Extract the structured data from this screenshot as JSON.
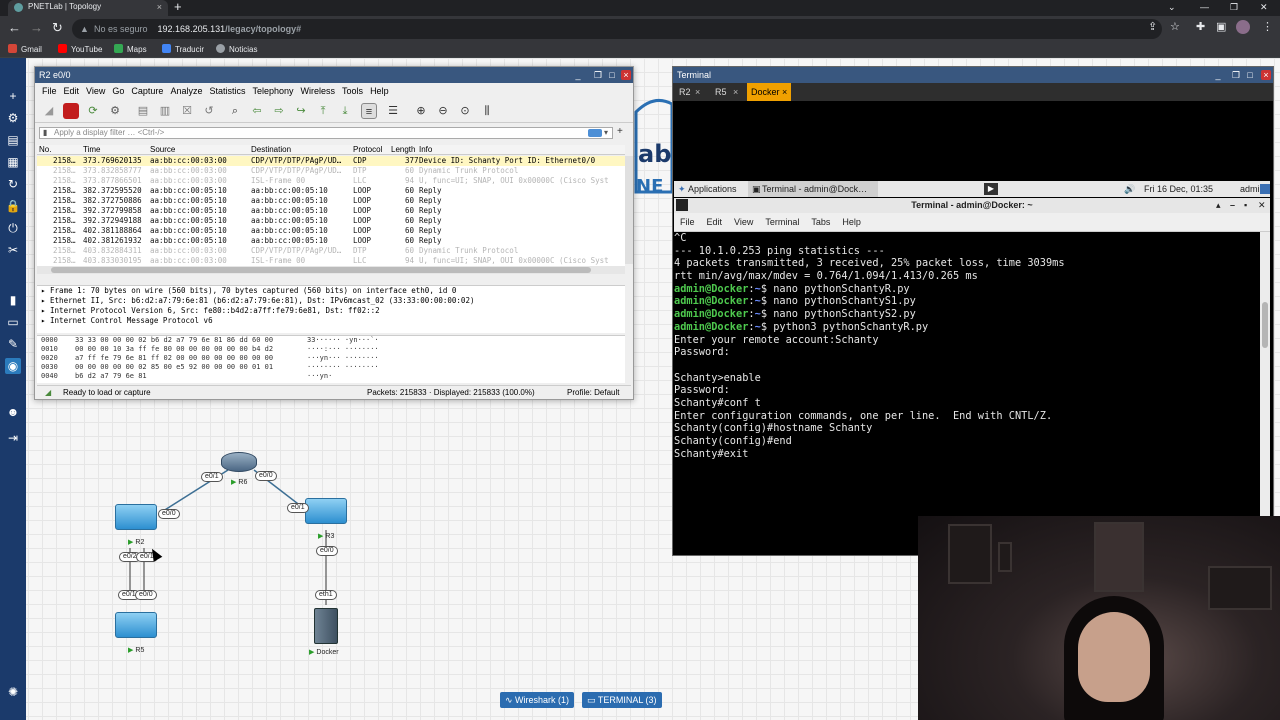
{
  "browser": {
    "tab_title": "PNETLab | Topology",
    "tab_close": "×",
    "new_tab": "+",
    "security_label": "No es seguro",
    "host": "192.168.205.131",
    "path": "/legacy/topology#",
    "bookmarks": [
      "Gmail",
      "YouTube",
      "Maps",
      "Traducir",
      "Noticias"
    ]
  },
  "wireshark": {
    "title": "R2 e0/0",
    "menu": [
      "File",
      "Edit",
      "View",
      "Go",
      "Capture",
      "Analyze",
      "Statistics",
      "Telephony",
      "Wireless",
      "Tools",
      "Help"
    ],
    "filter_placeholder": "Apply a display filter … <Ctrl-/>",
    "columns": [
      "No.",
      "Time",
      "Source",
      "Destination",
      "Protocol",
      "Length",
      "Info"
    ],
    "packets": [
      {
        "no": "2158…",
        "time": "373.769620135",
        "src": "aa:bb:cc:00:03:00",
        "dst": "CDP/VTP/DTP/PAgP/UD…",
        "proto": "CDP",
        "len": "377",
        "info": "Device ID: Schanty  Port ID: Ethernet0/0",
        "style": "sel"
      },
      {
        "no": "2158…",
        "time": "373.832858777",
        "src": "aa:bb:cc:00:03:00",
        "dst": "CDP/VTP/DTP/PAgP/UD…",
        "proto": "DTP",
        "len": "60",
        "info": "Dynamic Trunk Protocol",
        "style": "faded"
      },
      {
        "no": "2158…",
        "time": "373.877866501",
        "src": "aa:bb:cc:00:03:00",
        "dst": "ISL-Frame 00",
        "proto": "LLC",
        "len": "94",
        "info": "U, func=UI; SNAP, OUI 0x00000C (Cisco Syst",
        "style": "faded"
      },
      {
        "no": "2158…",
        "time": "382.372595520",
        "src": "aa:bb:cc:00:05:10",
        "dst": "aa:bb:cc:00:05:10",
        "proto": "LOOP",
        "len": "60",
        "info": "Reply",
        "style": "normal"
      },
      {
        "no": "2158…",
        "time": "382.372750886",
        "src": "aa:bb:cc:00:05:10",
        "dst": "aa:bb:cc:00:05:10",
        "proto": "LOOP",
        "len": "60",
        "info": "Reply",
        "style": "normal"
      },
      {
        "no": "2158…",
        "time": "392.372799858",
        "src": "aa:bb:cc:00:05:10",
        "dst": "aa:bb:cc:00:05:10",
        "proto": "LOOP",
        "len": "60",
        "info": "Reply",
        "style": "normal"
      },
      {
        "no": "2158…",
        "time": "392.372949188",
        "src": "aa:bb:cc:00:05:10",
        "dst": "aa:bb:cc:00:05:10",
        "proto": "LOOP",
        "len": "60",
        "info": "Reply",
        "style": "normal"
      },
      {
        "no": "2158…",
        "time": "402.381188864",
        "src": "aa:bb:cc:00:05:10",
        "dst": "aa:bb:cc:00:05:10",
        "proto": "LOOP",
        "len": "60",
        "info": "Reply",
        "style": "normal"
      },
      {
        "no": "2158…",
        "time": "402.381261932",
        "src": "aa:bb:cc:00:05:10",
        "dst": "aa:bb:cc:00:05:10",
        "proto": "LOOP",
        "len": "60",
        "info": "Reply",
        "style": "normal"
      },
      {
        "no": "2158…",
        "time": "403.832884311",
        "src": "aa:bb:cc:00:03:00",
        "dst": "CDP/VTP/DTP/PAgP/UD…",
        "proto": "DTP",
        "len": "60",
        "info": "Dynamic Trunk Protocol",
        "style": "faded"
      },
      {
        "no": "2158…",
        "time": "403.833030195",
        "src": "aa:bb:cc:00:03:00",
        "dst": "ISL-Frame 00",
        "proto": "LLC",
        "len": "94",
        "info": "U, func=UI; SNAP, OUI 0x00000C (Cisco Syst",
        "style": "faded"
      }
    ],
    "details": [
      "Frame 1: 70 bytes on wire (560 bits), 70 bytes captured (560 bits) on interface eth0, id 0",
      "Ethernet II, Src: b6:d2:a7:79:6e:81 (b6:d2:a7:79:6e:81), Dst: IPv6mcast_02 (33:33:00:00:00:02)",
      "Internet Protocol Version 6, Src: fe80::b4d2:a7ff:fe79:6e81, Dst: ff02::2",
      "Internet Control Message Protocol v6"
    ],
    "hex": [
      {
        "off": "0000",
        "bytes": "33 33 00 00 00 02 b6 d2  a7 79 6e 81 86 dd 60 00",
        "ascii": "33······ ·yn···`·"
      },
      {
        "off": "0010",
        "bytes": "00 00 00 10 3a ff fe 80  00 00 00 00 00 00 b4 d2",
        "ascii": "····:··· ········"
      },
      {
        "off": "0020",
        "bytes": "a7 ff fe 79 6e 81 ff 02  00 00 00 00 00 00 00 00",
        "ascii": "···yn··· ········"
      },
      {
        "off": "0030",
        "bytes": "00 00 00 00 00 02 85 00  e5 92 00 00 00 00 01 01",
        "ascii": "········ ········"
      },
      {
        "off": "0040",
        "bytes": "b6 d2 a7 79 6e 81",
        "ascii": "···yn·"
      }
    ],
    "status_ready": "Ready to load or capture",
    "status_packets": "Packets: 215833 · Displayed: 215833 (100.0%)",
    "status_profile": "Profile: Default"
  },
  "terminal_window": {
    "title": "Terminal",
    "tabs": [
      "R2",
      "R5",
      "Docker"
    ],
    "tab_close": "×",
    "panel_apps": "Applications",
    "panel_task": "Terminal - admin@Dock…",
    "panel_time": "Fri 16 Dec, 01:35",
    "panel_user": "admin",
    "xterm_title": "Terminal - admin@Docker: ~",
    "xterm_menu": [
      "File",
      "Edit",
      "View",
      "Terminal",
      "Tabs",
      "Help"
    ],
    "lines": [
      {
        "text": "^C"
      },
      {
        "text": "--- 10.1.0.253 ping statistics ---"
      },
      {
        "text": "4 packets transmitted, 3 received, 25% packet loss, time 3039ms"
      },
      {
        "text": "rtt min/avg/max/mdev = 0.764/1.094/1.413/0.265 ms"
      },
      {
        "prompt": "admin@Docker",
        "path": "~",
        "cmd": "$ nano pythonSchantyR.py"
      },
      {
        "prompt": "admin@Docker",
        "path": "~",
        "cmd": "$ nano pythonSchantyS1.py"
      },
      {
        "prompt": "admin@Docker",
        "path": "~",
        "cmd": "$ nano pythonSchantyS2.py"
      },
      {
        "prompt": "admin@Docker",
        "path": "~",
        "cmd": "$ python3 pythonSchantyR.py"
      },
      {
        "text": "Enter your remote account:Schanty"
      },
      {
        "text": "Password:"
      },
      {
        "text": ""
      },
      {
        "text": "Schanty>enable"
      },
      {
        "text": "Password:"
      },
      {
        "text": "Schanty#conf t"
      },
      {
        "text": "Enter configuration commands, one per line.  End with CNTL/Z."
      },
      {
        "text": "Schanty(config)#hostname Schanty"
      },
      {
        "text": "Schanty(config)#end"
      },
      {
        "text": "Schanty#exit"
      }
    ]
  },
  "topology": {
    "nodes": {
      "r6": "R6",
      "r2": "R2",
      "r3": "R3",
      "r5": "R5",
      "docker": "Docker"
    },
    "ifaces": {
      "r6_left": "e0/1",
      "r6_right": "e0/0",
      "r2_top": "e0/0",
      "r2_b1": "e0/2",
      "r2_b2": "e0/1",
      "r3_left": "e0/1",
      "r3_bottom": "e0/0",
      "r5_t1": "e0/1",
      "r5_t2": "e0/0",
      "docker_top": "eth1"
    },
    "logo_text": "ab",
    "logo_text2": "NE"
  },
  "taskbar": {
    "wireshark": "Wireshark (1)",
    "terminal": "TERMINAL (3)"
  },
  "colors": {
    "accent_blue": "#39577f",
    "pnet_sidebar": "#1b3a6b",
    "prompt_green": "#4ec94e",
    "docker_tab": "#f0a000"
  }
}
